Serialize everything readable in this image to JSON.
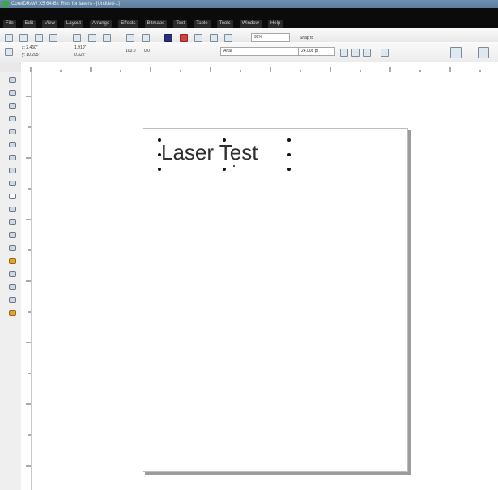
{
  "window": {
    "title": "CorelDRAW X5 64-Bit Files for lasers - [Untitled-1]"
  },
  "menubar": {
    "items": [
      "File",
      "Edit",
      "View",
      "Layout",
      "Arrange",
      "Effects",
      "Bitmaps",
      "Text",
      "Table",
      "Tools",
      "Window",
      "Help"
    ]
  },
  "standard_toolbar": {
    "zoom_value": "92%",
    "snap_label": "Snap to"
  },
  "property_bar": {
    "x_value": "x: 2.460\"",
    "y_value": "y: 10.295\"",
    "w_value": "1.910\"",
    "h_value": "0.322\"",
    "scale_value": "100.0",
    "angle_value": "0.0",
    "font_name": "Arial",
    "font_size": "24.008 pt"
  },
  "canvas": {
    "text_object": "Laser Test"
  },
  "icons": [
    "new-icon",
    "open-icon",
    "save-icon",
    "print-icon",
    "cut-icon",
    "copy-icon",
    "paste-icon",
    "undo-icon",
    "redo-icon",
    "import-icon",
    "export-icon",
    "launch-icon",
    "app-icon"
  ],
  "colors": {
    "menubar_bg": "#0b0b0b",
    "titlebar_bg": "#6f8fb0",
    "page_shadow": "#9c9c9c"
  }
}
